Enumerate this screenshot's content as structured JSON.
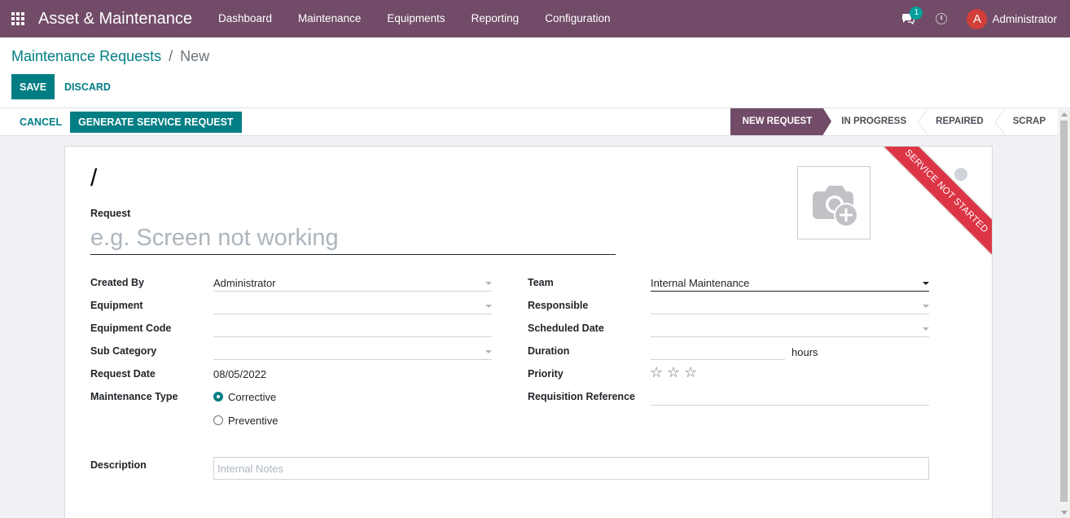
{
  "navbar": {
    "app_title": "Asset & Maintenance",
    "menu": [
      "Dashboard",
      "Maintenance",
      "Equipments",
      "Reporting",
      "Configuration"
    ],
    "chat_badge": "1",
    "user_initial": "A",
    "user_name": "Administrator",
    "brand_color": "#714b67",
    "avatar_color": "#d23f3a"
  },
  "control_panel": {
    "breadcrumb_parent": "Maintenance Requests",
    "breadcrumb_separator": "/",
    "breadcrumb_current": "New",
    "save_label": "SAVE",
    "discard_label": "DISCARD"
  },
  "statusbar": {
    "cancel_label": "CANCEL",
    "generate_label": "GENERATE SERVICE REQUEST",
    "stages": [
      "NEW REQUEST",
      "IN PROGRESS",
      "REPAIRED",
      "SCRAP"
    ],
    "active_stage": "NEW REQUEST",
    "accent_color": "#017e84"
  },
  "form": {
    "title": "/",
    "request_label": "Request",
    "request_placeholder": "e.g. Screen not working",
    "ribbon": "SERVICE NOT STARTED",
    "ribbon_color": "#dc3545",
    "left": {
      "created_by_label": "Created By",
      "created_by_value": "Administrator",
      "equipment_label": "Equipment",
      "equipment_value": "",
      "equipment_code_label": "Equipment Code",
      "equipment_code_value": "",
      "sub_category_label": "Sub Category",
      "sub_category_value": "",
      "request_date_label": "Request Date",
      "request_date_value": "08/05/2022",
      "maintenance_type_label": "Maintenance Type",
      "maintenance_type_options": [
        "Corrective",
        "Preventive"
      ],
      "maintenance_type_selected": "Corrective"
    },
    "right": {
      "team_label": "Team",
      "team_value": "Internal Maintenance",
      "responsible_label": "Responsible",
      "responsible_value": "",
      "scheduled_date_label": "Scheduled Date",
      "scheduled_date_value": "",
      "duration_label": "Duration",
      "duration_value": "",
      "duration_unit": "hours",
      "priority_label": "Priority",
      "priority_stars": 0,
      "priority_max": 3,
      "requisition_label": "Requisition Reference",
      "requisition_value": ""
    },
    "description_label": "Description",
    "description_placeholder": "Internal Notes"
  }
}
